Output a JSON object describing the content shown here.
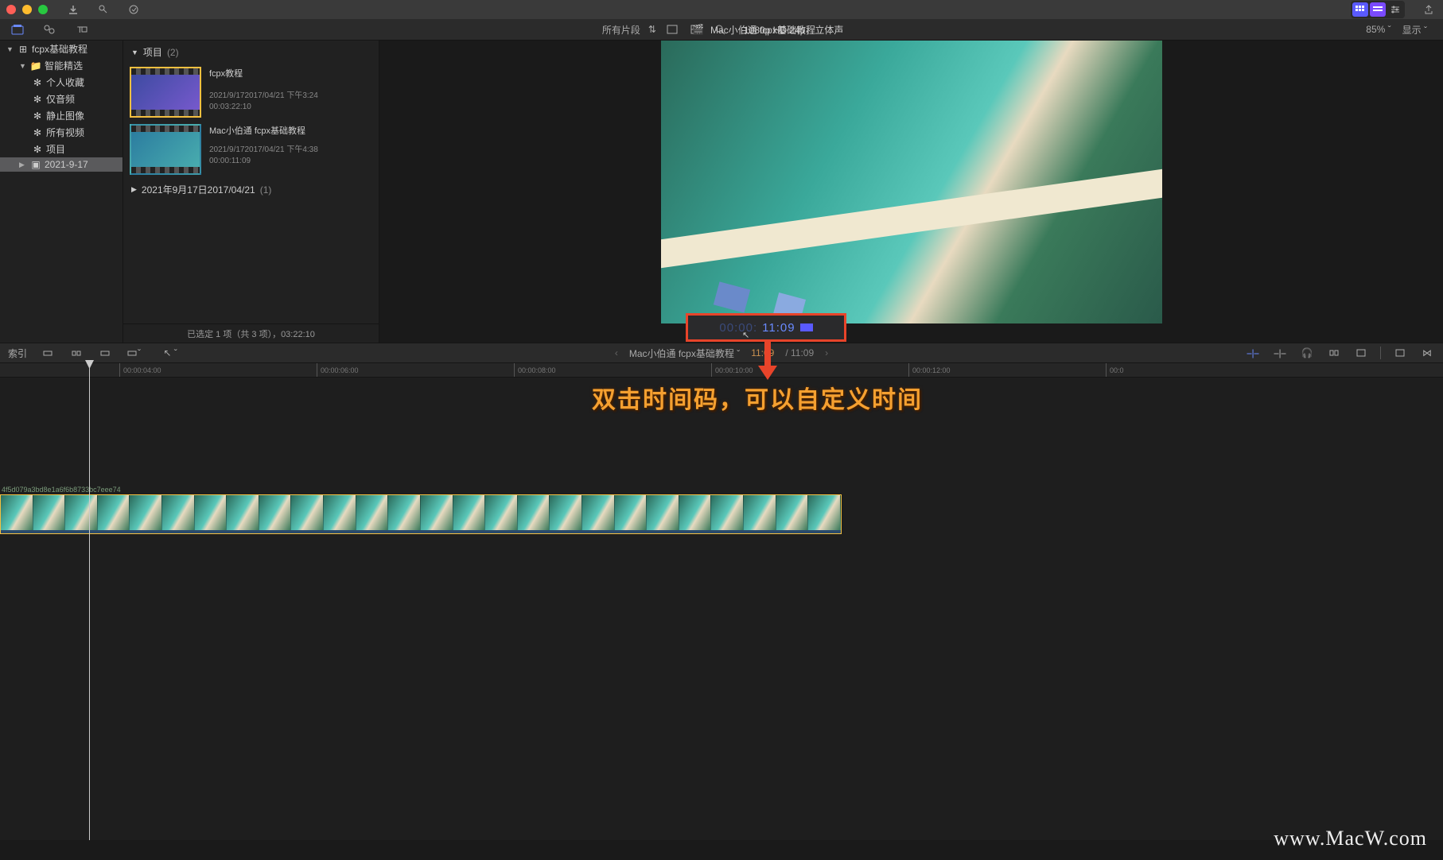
{
  "toolbar": {
    "clips_menu": "所有片段",
    "format": "1080p HD 24p，立体声",
    "project_title": "Mac小伯通 fcpx基础教程",
    "zoom": "85%",
    "display": "显示"
  },
  "sidebar": {
    "library": "fcpx基础教程",
    "smart": "智能精选",
    "items": [
      "个人收藏",
      "仅音频",
      "静止图像",
      "所有视频",
      "项目"
    ],
    "event": "2021-9-17"
  },
  "browser": {
    "header": "项目",
    "header_count": "(2)",
    "projects": [
      {
        "title": "fcpx教程",
        "date": "2021/9/172017/04/21 下午3:24",
        "duration": "00:03:22:10"
      },
      {
        "title": "Mac小伯通 fcpx基础教程",
        "date": "2021/9/172017/04/21 下午4:38",
        "duration": "00:00:11:09"
      }
    ],
    "group": "2021年9月17日2017/04/21",
    "group_count": "(1)",
    "footer": "已选定 1 项（共 3 项），03:22:10"
  },
  "timecode": {
    "dim": "00:00:",
    "bright": "11:09"
  },
  "annotation": "双击时间码，可以自定义时间",
  "timeline_bar": {
    "index": "索引",
    "project": "Mac小伯通 fcpx基础教程",
    "time_current": "11:09",
    "time_total": " / 11:09"
  },
  "ruler": [
    {
      "pos": 150,
      "label": "00:00:04:00"
    },
    {
      "pos": 398,
      "label": "00:00:06:00"
    },
    {
      "pos": 646,
      "label": "00:00:08:00"
    },
    {
      "pos": 894,
      "label": "00:00:10:00"
    },
    {
      "pos": 1142,
      "label": "00:00:12:00"
    },
    {
      "pos": 1390,
      "label": "00:0"
    }
  ],
  "clip_id": "4f5d079a3bd8e1a6f6b8733bc7eee74",
  "watermark": "www.MacW.com"
}
